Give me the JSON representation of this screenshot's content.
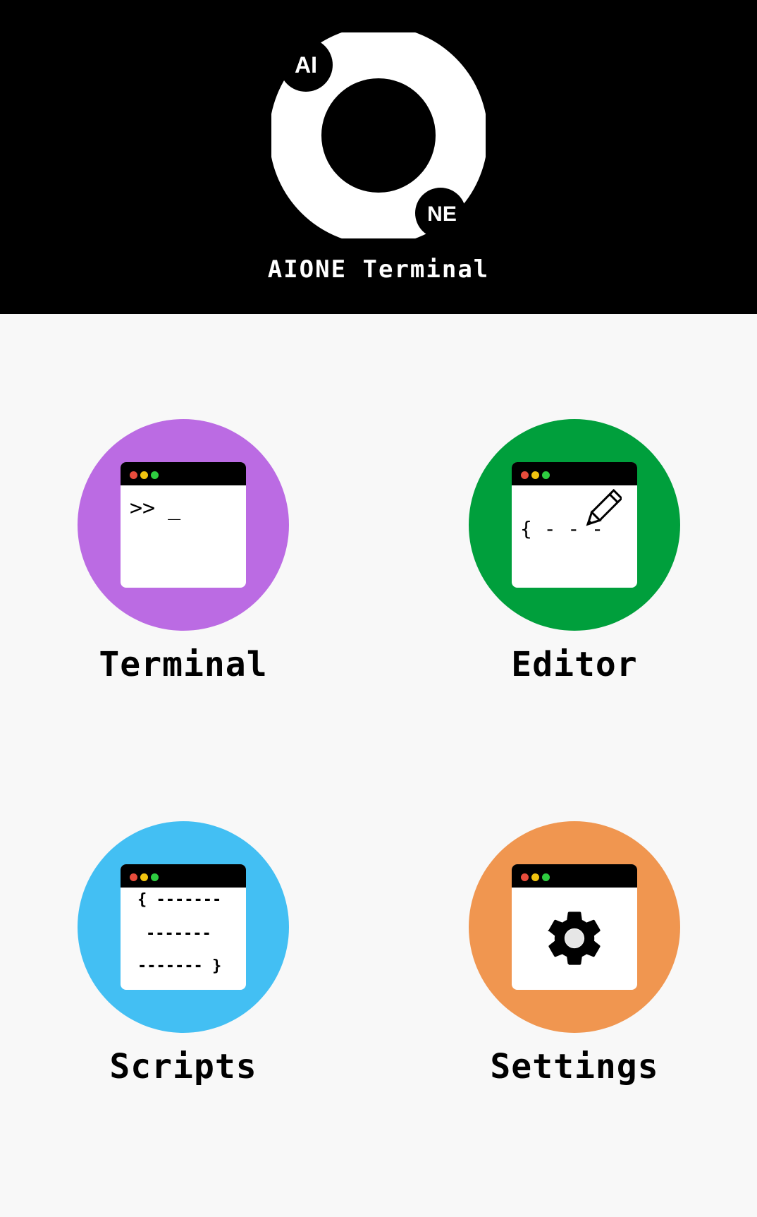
{
  "app": {
    "title": "AIONE Terminal",
    "logo": {
      "badge_top": "AI",
      "badge_bottom": "NE"
    }
  },
  "tiles": [
    {
      "label": "Terminal",
      "color": "#bb6be3",
      "icon": "terminal-window-icon",
      "content": [
        ">> _"
      ]
    },
    {
      "label": "Editor",
      "color": "#009f3c",
      "icon": "editor-pencil-icon",
      "content": [
        "{ - - -"
      ]
    },
    {
      "label": "Scripts",
      "color": "#43bff3",
      "icon": "scripts-braces-icon",
      "content": [
        "{ -------",
        "-------",
        "------- }"
      ]
    },
    {
      "label": "Settings",
      "color": "#f09650",
      "icon": "gear-icon",
      "content": []
    }
  ]
}
